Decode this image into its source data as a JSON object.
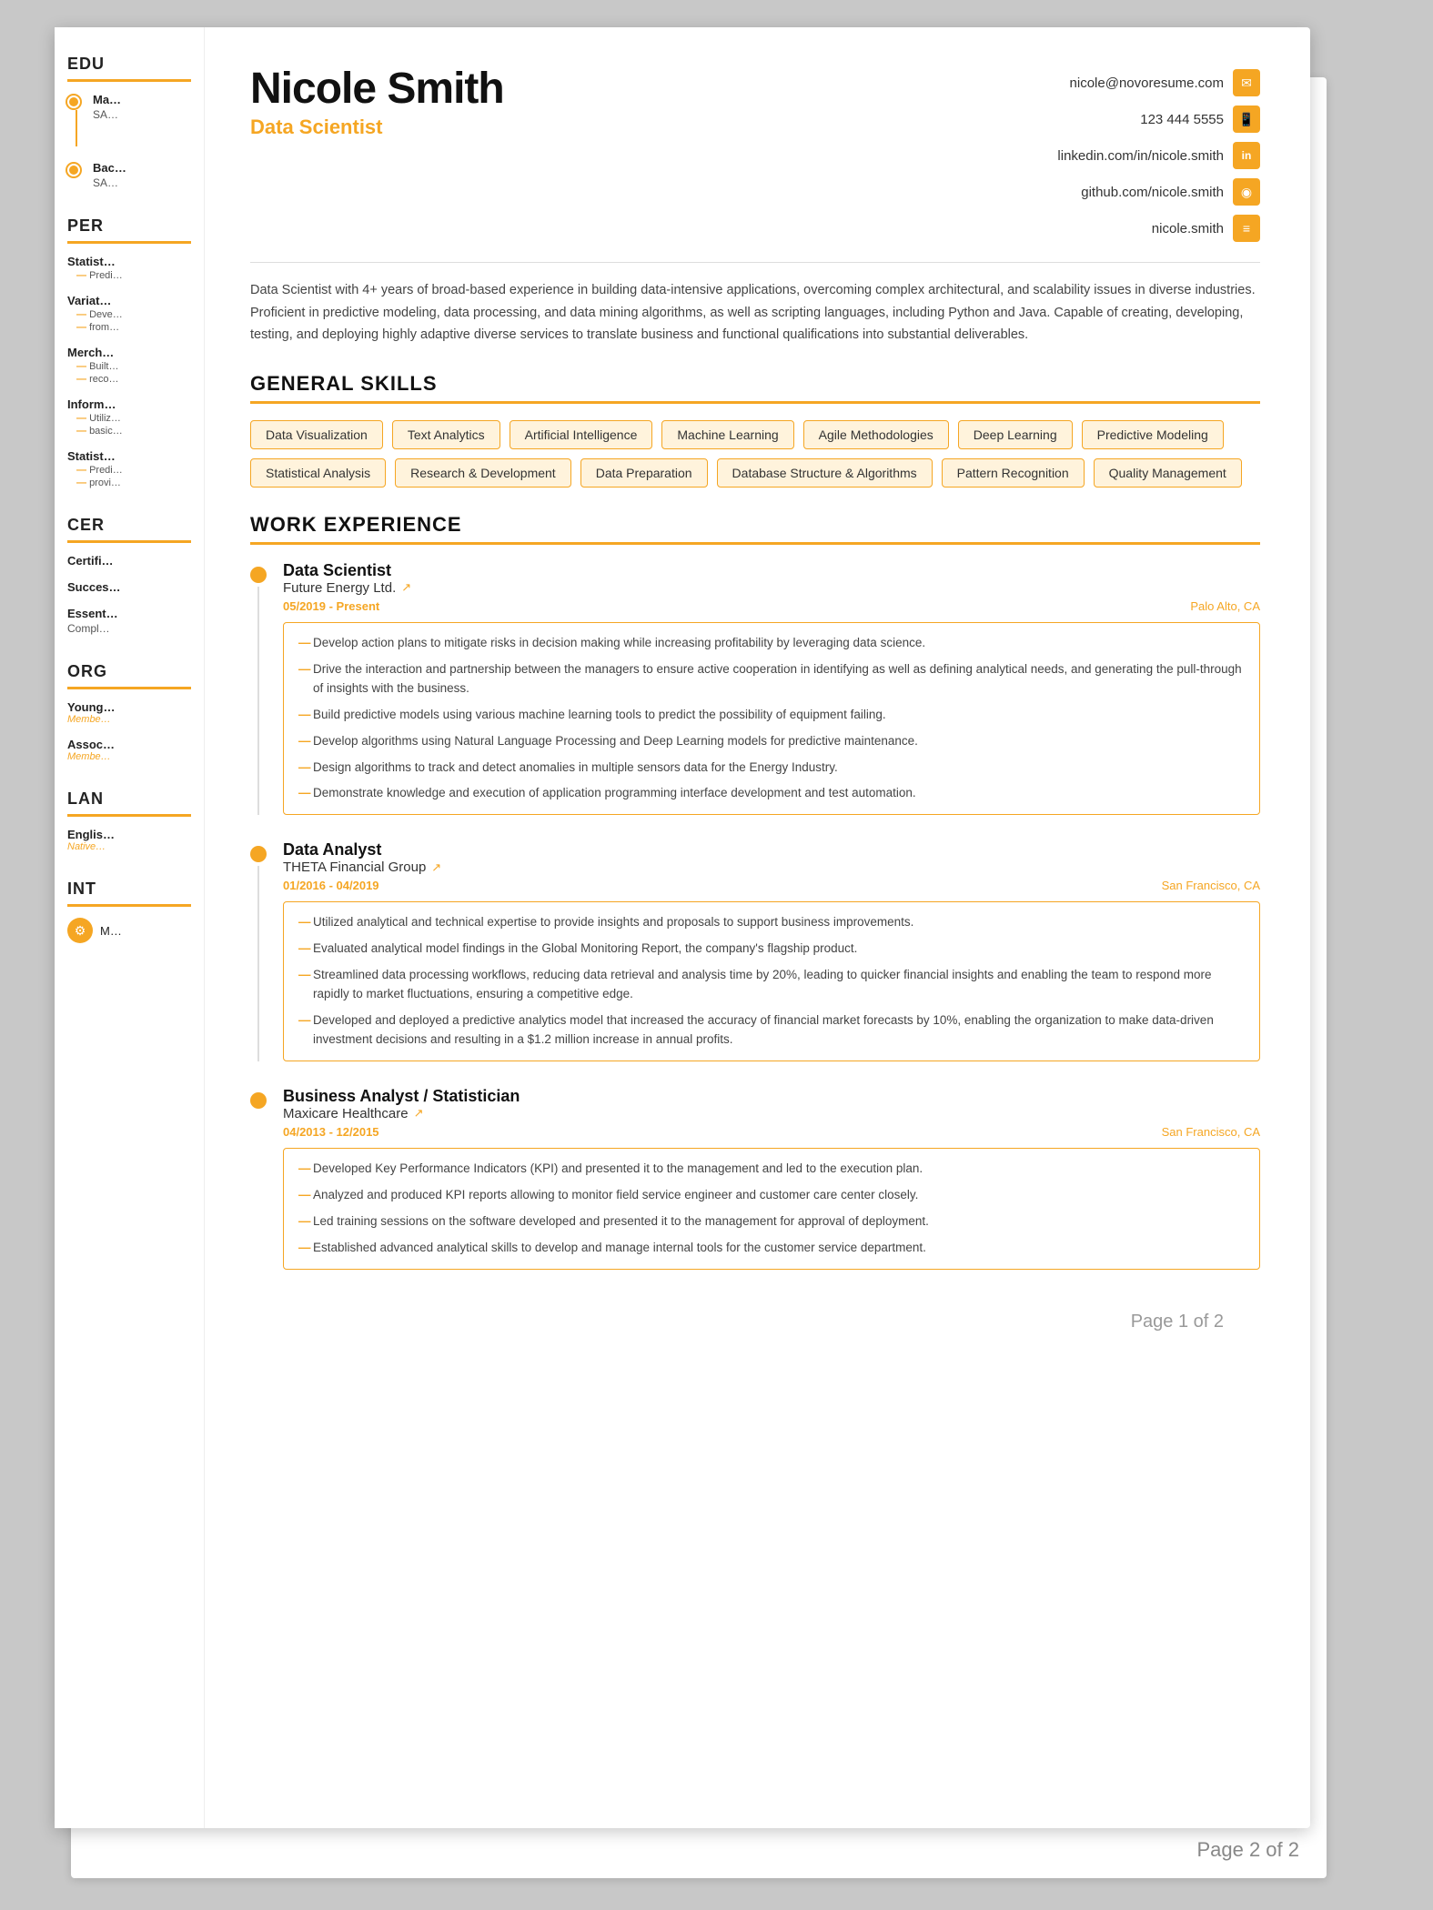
{
  "meta": {
    "page1_label": "Page 1 of 2",
    "page2_label": "Page 2 of 2"
  },
  "header": {
    "name": "Nicole Smith",
    "job_title": "Data Scientist",
    "contact": [
      {
        "icon": "✉",
        "text": "nicole@novoresume.com"
      },
      {
        "icon": "📱",
        "text": "123 444 5555"
      },
      {
        "icon": "in",
        "text": "linkedin.com/in/nicole.smith"
      },
      {
        "icon": "◎",
        "text": "github.com/nicole.smith"
      },
      {
        "icon": "≡",
        "text": "nicole.smith"
      }
    ]
  },
  "summary": "Data Scientist with 4+ years of broad-based experience in building data-intensive applications, overcoming complex architectural, and scalability issues in diverse industries. Proficient in predictive modeling, data processing, and data mining algorithms, as well as scripting languages, including Python and Java. Capable of creating, developing, testing, and deploying highly adaptive diverse services to translate business and functional qualifications into substantial deliverables.",
  "skills_section_title": "GENERAL SKILLS",
  "skills": [
    "Data Visualization",
    "Text Analytics",
    "Artificial Intelligence",
    "Machine Learning",
    "Agile Methodologies",
    "Deep Learning",
    "Predictive Modeling",
    "Statistical Analysis",
    "Research & Development",
    "Data Preparation",
    "Database Structure & Algorithms",
    "Pattern Recognition",
    "Quality Management"
  ],
  "work_section_title": "WORK EXPERIENCE",
  "work_items": [
    {
      "role": "Data Scientist",
      "company": "Future Energy Ltd.",
      "date": "05/2019 - Present",
      "location": "Palo Alto, CA",
      "bullets": [
        "Develop action plans to mitigate risks in decision making while increasing profitability by leveraging data science.",
        "Drive the interaction and partnership between the managers to ensure active cooperation in identifying as well as defining analytical needs, and generating the pull-through of insights with the business.",
        "Build predictive models using various machine learning tools to predict the possibility of equipment failing.",
        "Develop algorithms using Natural Language Processing and Deep Learning models for predictive maintenance.",
        "Design algorithms to track and detect anomalies in multiple sensors data for the Energy Industry.",
        "Demonstrate knowledge and execution of application programming interface development and test automation."
      ]
    },
    {
      "role": "Data Analyst",
      "company": "THETA Financial Group",
      "date": "01/2016 - 04/2019",
      "location": "San Francisco, CA",
      "bullets": [
        "Utilized analytical and technical expertise to provide insights and proposals to support business improvements.",
        "Evaluated analytical model findings in the Global Monitoring Report, the company's flagship product.",
        "Streamlined data processing workflows, reducing data retrieval and analysis time by 20%, leading to quicker financial insights and enabling the team to respond more rapidly to market fluctuations, ensuring a competitive edge.",
        "Developed and deployed a predictive analytics model that increased the accuracy of financial market forecasts by 10%, enabling the organization to make data-driven investment decisions and resulting in a $1.2 million increase in annual profits."
      ]
    },
    {
      "role": "Business Analyst / Statistician",
      "company": "Maxicare Healthcare",
      "date": "04/2013 - 12/2015",
      "location": "San Francisco, CA",
      "bullets": [
        "Developed Key Performance Indicators (KPI) and presented it to the management and led to the execution plan.",
        "Analyzed and produced KPI reports allowing to monitor field service engineer and customer care center closely.",
        "Led training sessions on the software developed and presented it to the management for approval of deployment.",
        "Established advanced analytical skills to develop and manage internal tools for the customer service department."
      ]
    }
  ],
  "sidebar": {
    "sections": [
      {
        "id": "edu",
        "title": "EDU",
        "items": [
          {
            "degree": "Ma…",
            "school": "SA…",
            "has_line": true
          },
          {
            "degree": "Bac…",
            "school": "SA…",
            "has_line": false
          }
        ]
      },
      {
        "id": "per",
        "title": "PER",
        "items": [
          {
            "title": "Statist…",
            "bullets": [
              "Predi…"
            ]
          },
          {
            "title": "Variat…",
            "bullets": [
              "Deve…",
              "from…"
            ]
          },
          {
            "title": "Merch…",
            "bullets": [
              "Built…",
              "reco…"
            ]
          },
          {
            "title": "Inform…",
            "bullets": [
              "Utiliz…",
              "basic…"
            ]
          },
          {
            "title": "Statist…",
            "bullets": [
              "Predi…",
              "provi…"
            ]
          }
        ]
      },
      {
        "id": "cer",
        "title": "CER",
        "items": [
          {
            "name": "Certifi…"
          },
          {
            "name": "Succes…"
          },
          {
            "name": "Essent… Compl…"
          }
        ]
      },
      {
        "id": "org",
        "title": "ORG",
        "items": [
          {
            "org": "Young…",
            "role": "Membe…"
          },
          {
            "org": "Assoc…",
            "role": "Membe…"
          }
        ]
      },
      {
        "id": "lan",
        "title": "LAN",
        "items": [
          {
            "lang": "Englis…",
            "level": "Native…"
          }
        ]
      },
      {
        "id": "int",
        "title": "INT",
        "items": [
          {
            "interest": "M…",
            "icon": "⚙"
          }
        ]
      }
    ]
  }
}
